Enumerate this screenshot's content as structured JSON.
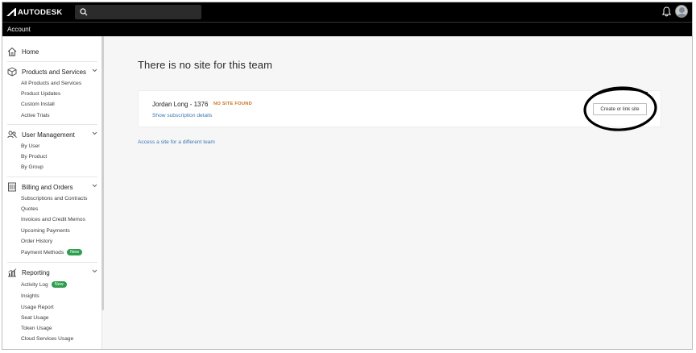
{
  "brand": {
    "logo_text": "AUTODESK"
  },
  "header": {
    "account_label": "Account"
  },
  "sidebar": {
    "home": "Home",
    "sections": [
      {
        "title": "Products and Services",
        "icon": "box-icon",
        "items": [
          {
            "label": "All Products and Services"
          },
          {
            "label": "Product Updates"
          },
          {
            "label": "Custom Install"
          },
          {
            "label": "Active Trials"
          }
        ]
      },
      {
        "title": "User Management",
        "icon": "users-icon",
        "items": [
          {
            "label": "By User"
          },
          {
            "label": "By Product"
          },
          {
            "label": "By Group"
          }
        ]
      },
      {
        "title": "Billing and Orders",
        "icon": "receipt-icon",
        "items": [
          {
            "label": "Subscriptions and Contracts"
          },
          {
            "label": "Quotes"
          },
          {
            "label": "Invoices and Credit Memos"
          },
          {
            "label": "Upcoming Payments"
          },
          {
            "label": "Order History"
          },
          {
            "label": "Payment Methods",
            "badge": "New"
          }
        ]
      },
      {
        "title": "Reporting",
        "icon": "chart-icon",
        "items": [
          {
            "label": "Activity Log",
            "badge": "New"
          },
          {
            "label": "Insights"
          },
          {
            "label": "Usage Report"
          },
          {
            "label": "Seat Usage"
          },
          {
            "label": "Token Usage"
          },
          {
            "label": "Cloud Services Usage"
          }
        ]
      }
    ]
  },
  "main": {
    "title": "There is no site for this team",
    "team": {
      "name": "Jordan Long - 1376",
      "status": "NO SITE FOUND",
      "details_link": "Show subscription details",
      "action_label": "Create or link site"
    },
    "alt_link": "Access a site for a different team"
  },
  "colors": {
    "topbar": "#000000",
    "link": "#3c78b5",
    "status": "#c8731f",
    "badge": "#2e9e4f"
  }
}
